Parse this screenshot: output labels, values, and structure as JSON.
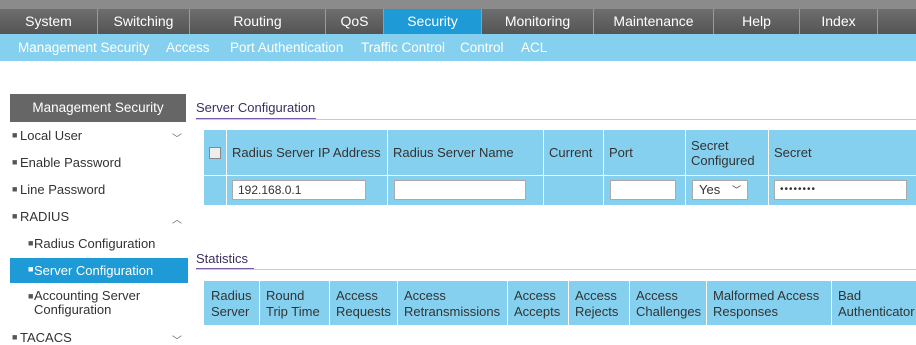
{
  "topnav": [
    "System",
    "Switching",
    "Routing",
    "QoS",
    "Security",
    "Monitoring",
    "Maintenance",
    "Help",
    "Index"
  ],
  "subnav": [
    "Management Security",
    "Access",
    "Port Authentication",
    "Traffic Control",
    "Control",
    "ACL"
  ],
  "sidebar": {
    "title": "Management Security",
    "items": [
      "Local User",
      "Enable Password",
      "Line Password",
      "RADIUS",
      "Radius Configuration",
      "Server Configuration",
      "Accounting Server Configuration",
      "TACACS"
    ]
  },
  "server_config": {
    "title": "Server Configuration",
    "headers": {
      "ip": "Radius Server IP Address",
      "name": "Radius Server Name",
      "current": "Current",
      "port": "Port",
      "secret_configured_1": "Secret",
      "secret_configured_2": "Configured",
      "secret": "Secret"
    },
    "row": {
      "ip": "192.168.0.1",
      "name": "",
      "port": "",
      "secret_configured": "Yes",
      "secret": "••••••••"
    }
  },
  "statistics": {
    "title": "Statistics",
    "headers": [
      [
        "Radius",
        "Server"
      ],
      [
        "Round",
        "Trip Time"
      ],
      [
        "Access",
        "Requests"
      ],
      [
        "Access",
        "Retransmissions"
      ],
      [
        "Access",
        "Accepts"
      ],
      [
        "Access",
        "Rejects"
      ],
      [
        "Access",
        "Challenges"
      ],
      [
        "Malformed Access",
        "Responses"
      ],
      [
        "Bad",
        "Authenticator"
      ]
    ]
  },
  "colors": {
    "accent": "#1e9ad6",
    "subnav": "#86d0ef",
    "topnav": "#555555",
    "rule": "#7c5aa6"
  }
}
